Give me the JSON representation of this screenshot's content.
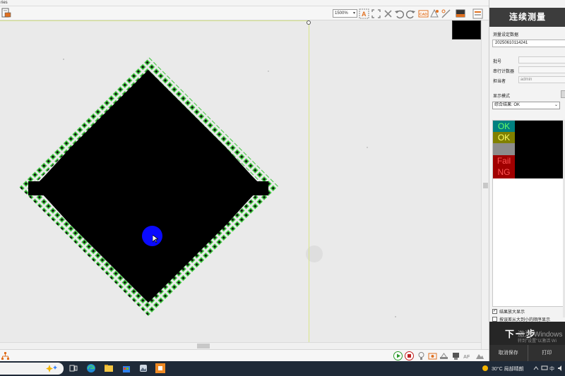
{
  "window": {
    "title_fragment": "ries"
  },
  "toolbar": {
    "zoom_value": "1500%",
    "zoom_arrow": "▾"
  },
  "right_panel": {
    "title": "连续测量",
    "settings_label": "测量设定数据",
    "settings_value": "20250610114241",
    "fields": [
      {
        "label": "批号",
        "value": ""
      },
      {
        "label": "串行计数器",
        "value": ""
      },
      {
        "label": "担当者",
        "value": "admin"
      }
    ],
    "display_mode_label": "显示模式",
    "combined_result_value": "综合结果: OK",
    "results": {
      "ok1": "OK",
      "ok2": "OK",
      "fail": "Fail",
      "ng": "NG"
    },
    "options": [
      {
        "label": "结果放大显示",
        "checked": true
      },
      {
        "label": "按误差从大到小的顺序显示",
        "checked": false
      }
    ],
    "next_button": "下一步",
    "watermark_line1": "激活 Windows",
    "watermark_line2": "转到\"设置\"以激活 Wi",
    "cancel_save_button": "取消保存",
    "print_button": "打印"
  },
  "taskbar": {
    "weather": "30°C 局部晴朗",
    "ime": "中"
  },
  "colors": {
    "ok_teal": "#008080",
    "ok_olive": "#808000",
    "fail_red": "#a00000",
    "cursor_blue": "#0a0aff",
    "pin_green": "#3ec83e"
  }
}
